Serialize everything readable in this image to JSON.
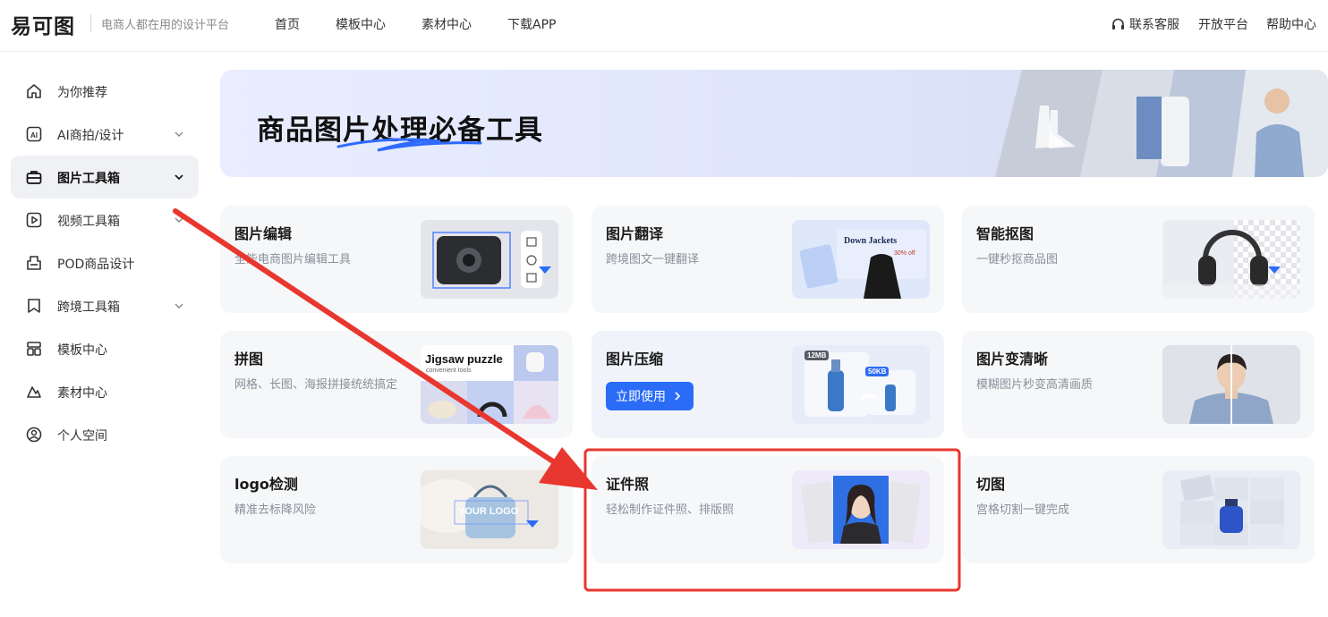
{
  "header": {
    "logo_text": "易可图",
    "slogan": "电商人都在用的设计平台",
    "nav": [
      "首页",
      "模板中心",
      "素材中心",
      "下载APP"
    ],
    "right": {
      "service": "联系客服",
      "open_platform": "开放平台",
      "help": "帮助中心"
    }
  },
  "sidebar": {
    "items": [
      {
        "label": "为你推荐",
        "icon": "home-icon"
      },
      {
        "label": "AI商拍/设计",
        "icon": "ai-icon",
        "expandable": true
      },
      {
        "label": "图片工具箱",
        "icon": "toolbox-icon",
        "expandable": true,
        "active": true
      },
      {
        "label": "视频工具箱",
        "icon": "video-icon",
        "expandable": true
      },
      {
        "label": "POD商品设计",
        "icon": "pod-icon"
      },
      {
        "label": "跨境工具箱",
        "icon": "crossborder-icon",
        "expandable": true
      },
      {
        "label": "模板中心",
        "icon": "template-icon"
      },
      {
        "label": "素材中心",
        "icon": "material-icon"
      },
      {
        "label": "个人空间",
        "icon": "user-icon"
      }
    ]
  },
  "banner": {
    "title": "商品图片处理必备工具"
  },
  "tools": [
    {
      "title": "图片编辑",
      "desc": "全能电商图片编辑工具"
    },
    {
      "title": "图片翻译",
      "desc": "跨境图文一键翻译",
      "thumb_text": "Down Jackets",
      "thumb_sub": "30% off"
    },
    {
      "title": "智能抠图",
      "desc": "一键秒抠商品图"
    },
    {
      "title": "拼图",
      "desc": "网格、长图、海报拼接统统搞定",
      "thumb_text": "Jigsaw puzzle",
      "thumb_sub": "convenient tools"
    },
    {
      "title": "图片压缩",
      "button": "立即使用",
      "size_before": "12MB",
      "size_after": "50KB"
    },
    {
      "title": "图片变清晰",
      "desc": "模糊图片秒变高清画质"
    },
    {
      "title": "logo检测",
      "desc": "精准去标降风险",
      "thumb_text": "YOUR LOGO"
    },
    {
      "title": "证件照",
      "desc": "轻松制作证件照、排版照"
    },
    {
      "title": "切图",
      "desc": "宫格切割一键完成"
    }
  ],
  "colors": {
    "accent": "#2b6cf6",
    "annotation": "#e8372f"
  }
}
